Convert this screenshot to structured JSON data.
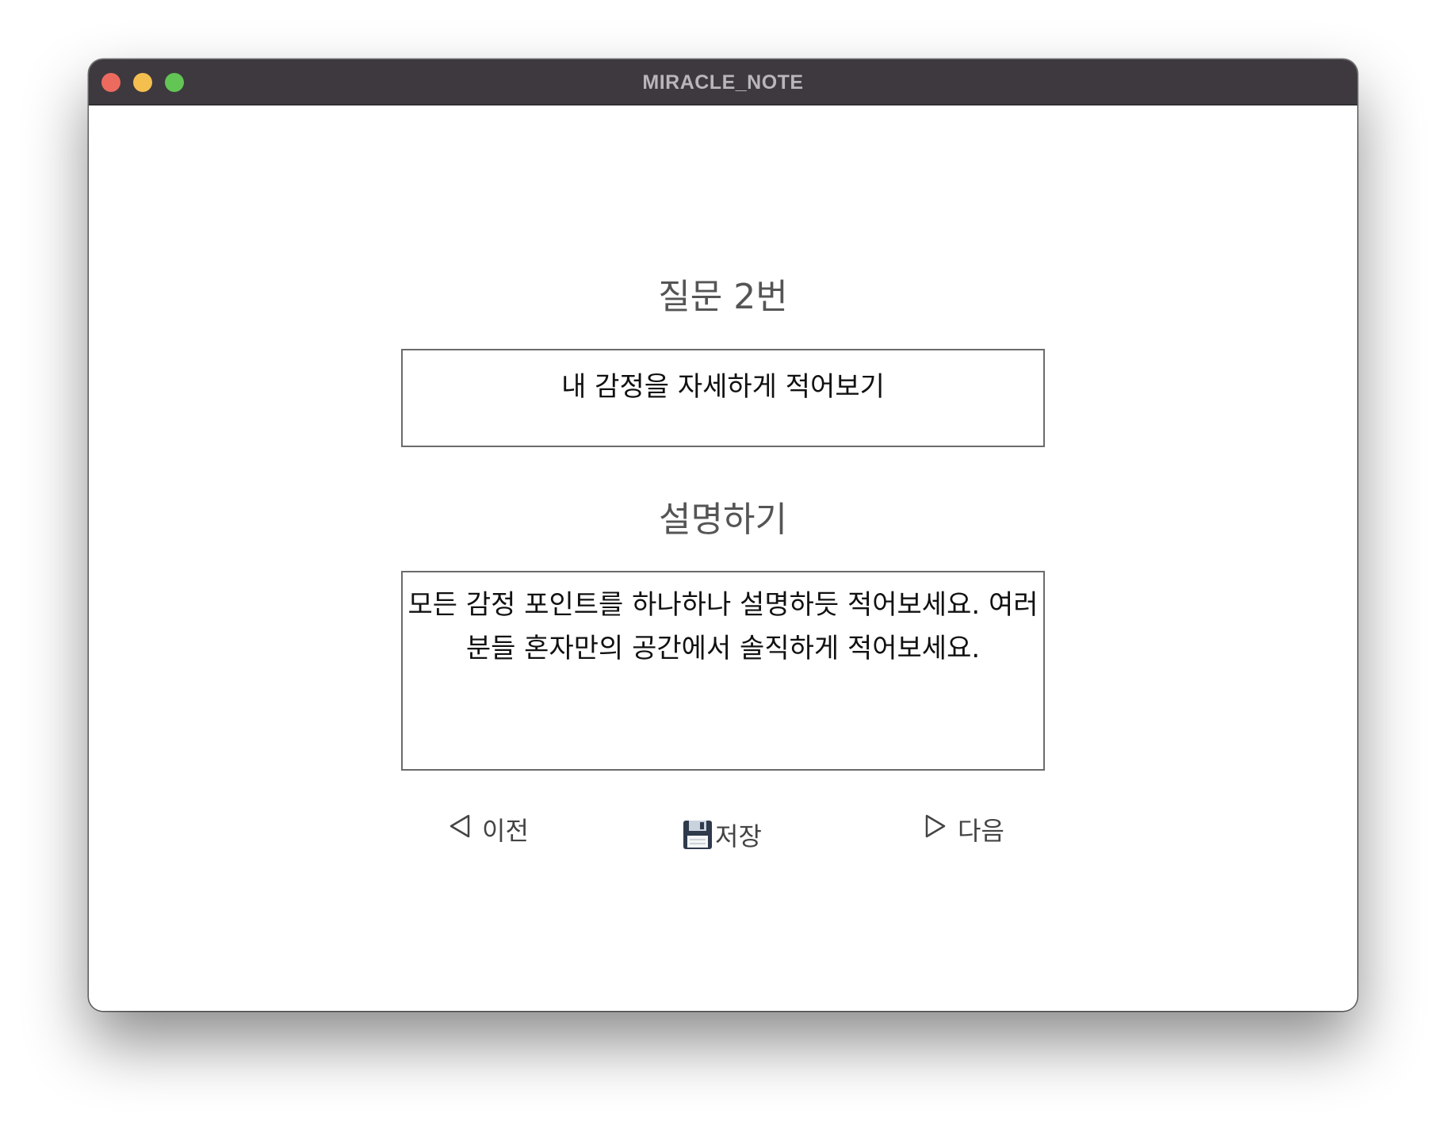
{
  "window": {
    "title": "MIRACLE_NOTE",
    "traffic_lights": {
      "close": "#ed6a5e",
      "minimize": "#f5bf4f",
      "zoom": "#62c554"
    }
  },
  "question": {
    "heading": "질문 2번",
    "prompt": "내 감정을 자세하게 적어보기"
  },
  "description": {
    "heading": "설명하기",
    "text_line1": "모든 감정 포인트를 하나하나 설명하듯 적어보세요. 여러",
    "text_line2": "분들 혼자만의 공간에서 솔직하게 적어보세요."
  },
  "navigation": {
    "prev_label": "이전",
    "prev_icon": "triangle-left-icon",
    "save_label": "저장",
    "save_icon": "floppy-disk-icon",
    "next_label": "다음",
    "next_icon": "triangle-right-icon"
  },
  "colors": {
    "titlebar": "#3d393f",
    "box_border": "#6b6b6b",
    "heading_text": "#555555"
  }
}
